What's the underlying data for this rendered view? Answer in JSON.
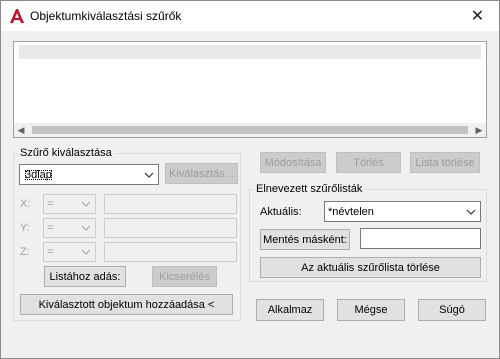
{
  "window": {
    "title": "Objektumkiválasztási szűrők",
    "close_glyph": "✕",
    "icon": "autocad-a-icon"
  },
  "filter_list": {
    "rows": [
      ""
    ]
  },
  "filter_selection": {
    "group_label": "Szűrő kiválasztása",
    "type_value": "3dlap",
    "select_button": "Kiválasztás...",
    "x_label": "X:",
    "y_label": "Y:",
    "z_label": "Z:",
    "x_op": "=",
    "y_op": "=",
    "z_op": "=",
    "add_to_list_button": "Listához adás:",
    "substitute_button": "Kicserélés",
    "add_selected_button": "Kiválasztott objektum hozzáadása <"
  },
  "list_buttons": {
    "edit": "Módosítása",
    "delete": "Törlés",
    "clear_list": "Lista törlése"
  },
  "named_filters": {
    "group_label": "Elnevezett szűrőlisták",
    "current_label": "Aktuális:",
    "current_value": "*névtelen",
    "save_as_button": "Mentés másként:",
    "save_as_value": "",
    "delete_current_button": "Az aktuális szűrőlista törlése"
  },
  "footer": {
    "apply": "Alkalmaz",
    "cancel": "Mégse",
    "help": "Súgó"
  },
  "colors": {
    "accent": "#0078d7",
    "logo_red": "#c8102e"
  }
}
